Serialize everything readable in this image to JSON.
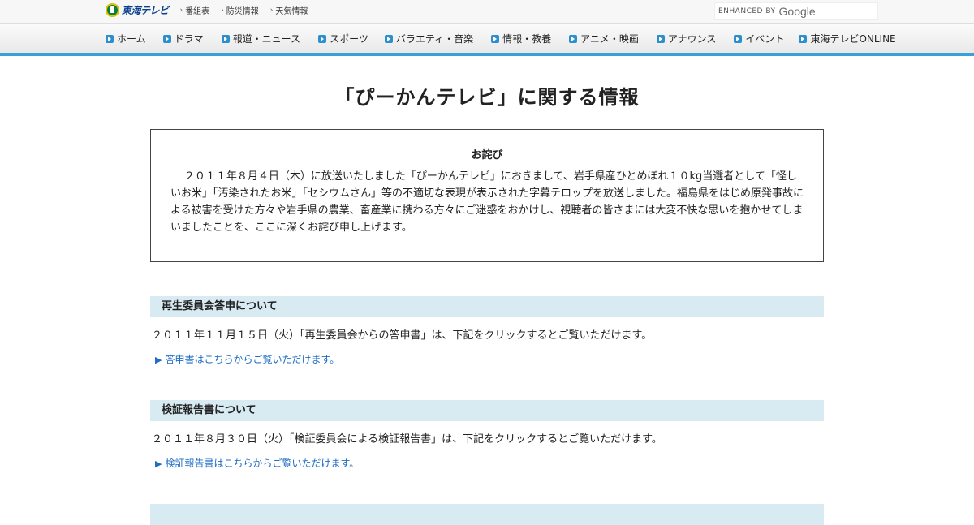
{
  "header": {
    "logo_text": "東海テレビ",
    "top_links": [
      "番組表",
      "防災情報",
      "天気情報"
    ],
    "search": {
      "enhanced_by": "ENHANCED BY",
      "provider": "Google"
    }
  },
  "nav": {
    "items": [
      "ホーム",
      "ドラマ",
      "報道・ニュース",
      "スポーツ",
      "バラエティ・音楽",
      "情報・教養",
      "アニメ・映画",
      "アナウンス",
      "イベント",
      "東海テレビONLINE"
    ]
  },
  "main": {
    "title": "「ぴーかんテレビ」に関する情報",
    "apology": {
      "heading": "お詫び",
      "body": "２０１１年８月４日（木）に放送いたしました「ぴーかんテレビ」におきまして、岩手県産ひとめぼれ１０kg当選者として「怪しいお米」「汚染されたお米」「セシウムさん」等の不適切な表現が表示された字幕テロップを放送しました。福島県をはじめ原発事故による被害を受けた方々や岩手県の農業、畜産業に携わる方々にご迷惑をおかけし、視聴者の皆さまには大変不快な思いを抱かせてしまいましたことを、ここに深くお詫び申し上げます。"
    },
    "sections": [
      {
        "heading": "再生委員会答申について",
        "body": "２０１１年１１月１５日（火）「再生委員会からの答申書」は、下記をクリックするとご覧いただけます。",
        "link": "答申書はこちらからご覧いただけます。"
      },
      {
        "heading": "検証報告書について",
        "body": "２０１１年８月３０日（火）「検証委員会による検証報告書」は、下記をクリックするとご覧いただけます。",
        "link": "検証報告書はこちらからご覧いただけます。"
      }
    ]
  },
  "colors": {
    "accent": "#3aa0d8",
    "section_bg": "#d8ebf3",
    "link": "#1e6cc4"
  }
}
